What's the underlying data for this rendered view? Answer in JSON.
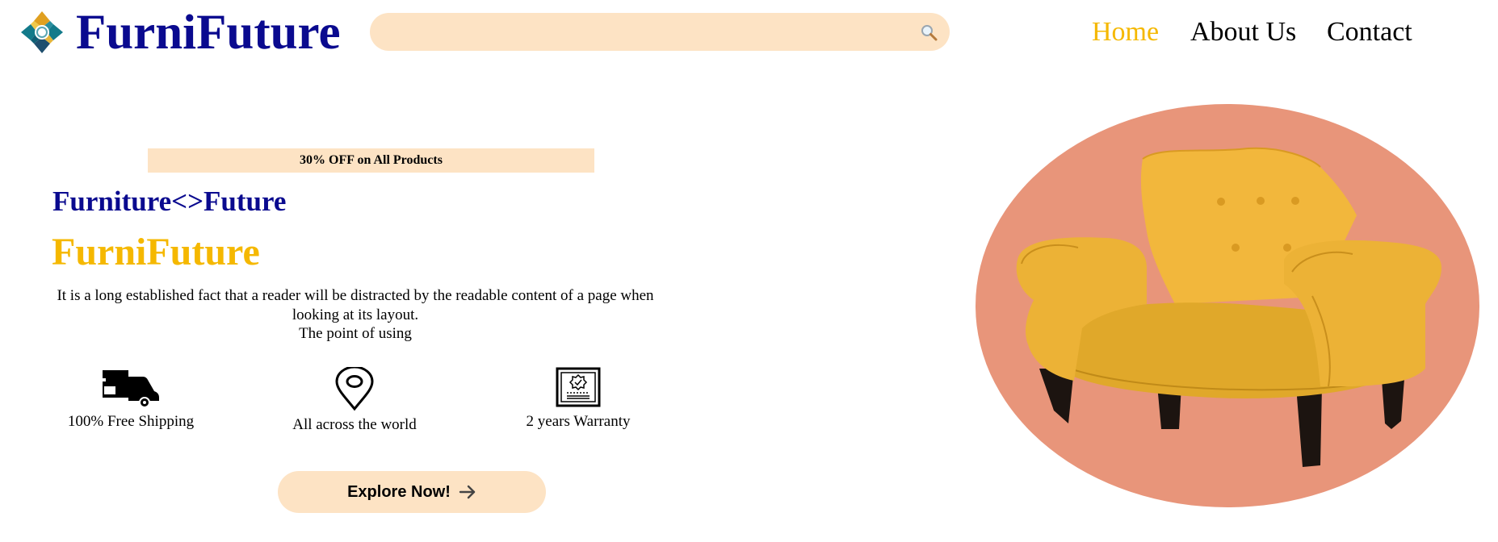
{
  "header": {
    "brand": "FurniFuture",
    "logo_icon": "diamond-logo-icon",
    "search": {
      "placeholder": "",
      "icon": "search-icon"
    },
    "nav": [
      {
        "label": "Home",
        "active": true
      },
      {
        "label": "About Us",
        "active": false
      },
      {
        "label": "Contact",
        "active": false
      }
    ]
  },
  "hero": {
    "promo": "30% OFF on All Products",
    "tagline": "Furniture<>Future",
    "brand": "FurniFuture",
    "description_lines": [
      "It is a long established fact that a reader will be distracted by the readable content of a page when",
      "looking at its layout.",
      "The point of using"
    ],
    "features": [
      {
        "icon": "truck-icon",
        "label": "100% Free Shipping"
      },
      {
        "icon": "map-pin-icon",
        "label": "All across the world"
      },
      {
        "icon": "certificate-icon",
        "label": "2 years Warranty"
      }
    ],
    "cta": {
      "label": "Explore Now!",
      "icon": "arrow-right-icon"
    },
    "image": {
      "subject": "yellow-armchair"
    }
  },
  "colors": {
    "brand_navy": "#0a0a8f",
    "accent_yellow": "#f5b800",
    "peach": "#fde3c4",
    "salmon": "#e8957a"
  }
}
